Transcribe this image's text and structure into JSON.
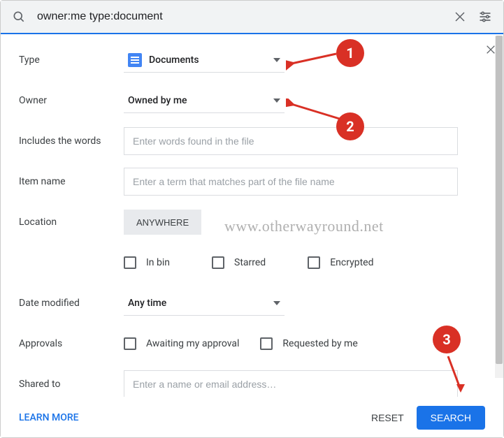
{
  "search": {
    "value": "owner:me type:document"
  },
  "filters": {
    "type": {
      "label": "Type",
      "value": "Documents"
    },
    "owner": {
      "label": "Owner",
      "value": "Owned by me"
    },
    "includes": {
      "label": "Includes the words",
      "placeholder": "Enter words found in the file"
    },
    "item_name": {
      "label": "Item name",
      "placeholder": "Enter a term that matches part of the file name"
    },
    "location": {
      "label": "Location",
      "button": "ANYWHERE"
    },
    "checkboxes": {
      "in_bin": "In bin",
      "starred": "Starred",
      "encrypted": "Encrypted"
    },
    "date_modified": {
      "label": "Date modified",
      "value": "Any time"
    },
    "approvals": {
      "label": "Approvals",
      "awaiting": "Awaiting my approval",
      "requested": "Requested by me"
    },
    "shared_to": {
      "label": "Shared to",
      "placeholder": "Enter a name or email address…"
    }
  },
  "footer": {
    "learn_more": "LEARN MORE",
    "reset": "RESET",
    "search": "SEARCH"
  },
  "annotations": {
    "b1": "1",
    "b2": "2",
    "b3": "3"
  },
  "watermark": "www.otherwayround.net"
}
